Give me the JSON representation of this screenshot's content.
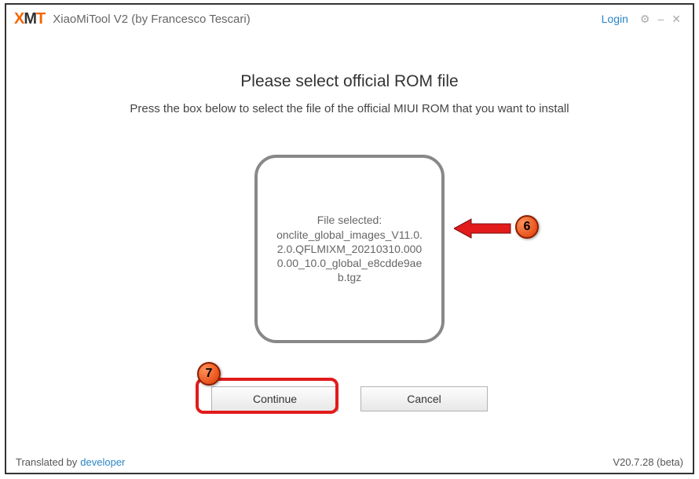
{
  "titlebar": {
    "logo": {
      "x": "X",
      "m": "M",
      "t": "T"
    },
    "title": "XiaoMiTool V2 (by Francesco Tescari)",
    "login": "Login"
  },
  "main": {
    "heading": "Please select official ROM file",
    "subheading": "Press the box below to select the file of the official MIUI ROM that you want to install",
    "filebox": {
      "label": "File selected:",
      "filename": "onclite_global_images_V11.0.2.0.QFLMIXM_20210310.0000.00_10.0_global_e8cdde9aeb.tgz"
    },
    "buttons": {
      "continue": "Continue",
      "cancel": "Cancel"
    }
  },
  "footer": {
    "translated_prefix": "Translated by",
    "translated_link": "developer",
    "version": "V20.7.28 (beta)"
  },
  "annotations": {
    "callout6": "6",
    "callout7": "7"
  }
}
